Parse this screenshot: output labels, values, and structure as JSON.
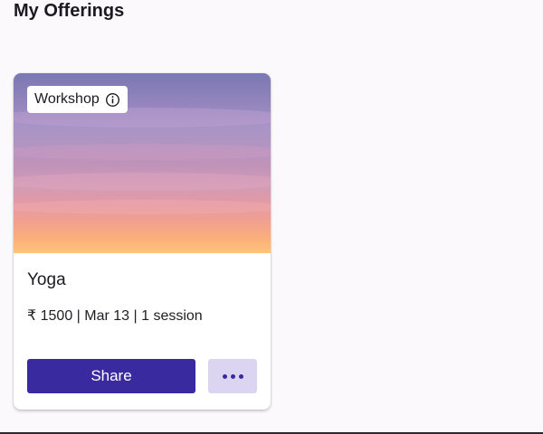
{
  "page": {
    "title": "My Offerings"
  },
  "offering_card": {
    "badge_label": "Workshop",
    "badge_icon": "info-icon",
    "title": "Yoga",
    "meta": "₹ 1500 | Mar 13 | 1 session",
    "share_label": "Share",
    "more_icon": "more-horizontal-icon"
  },
  "colors": {
    "primary": "#3a2aa0",
    "secondary_button_bg": "#dcd5f2",
    "page_bg": "#fcf9fd"
  }
}
